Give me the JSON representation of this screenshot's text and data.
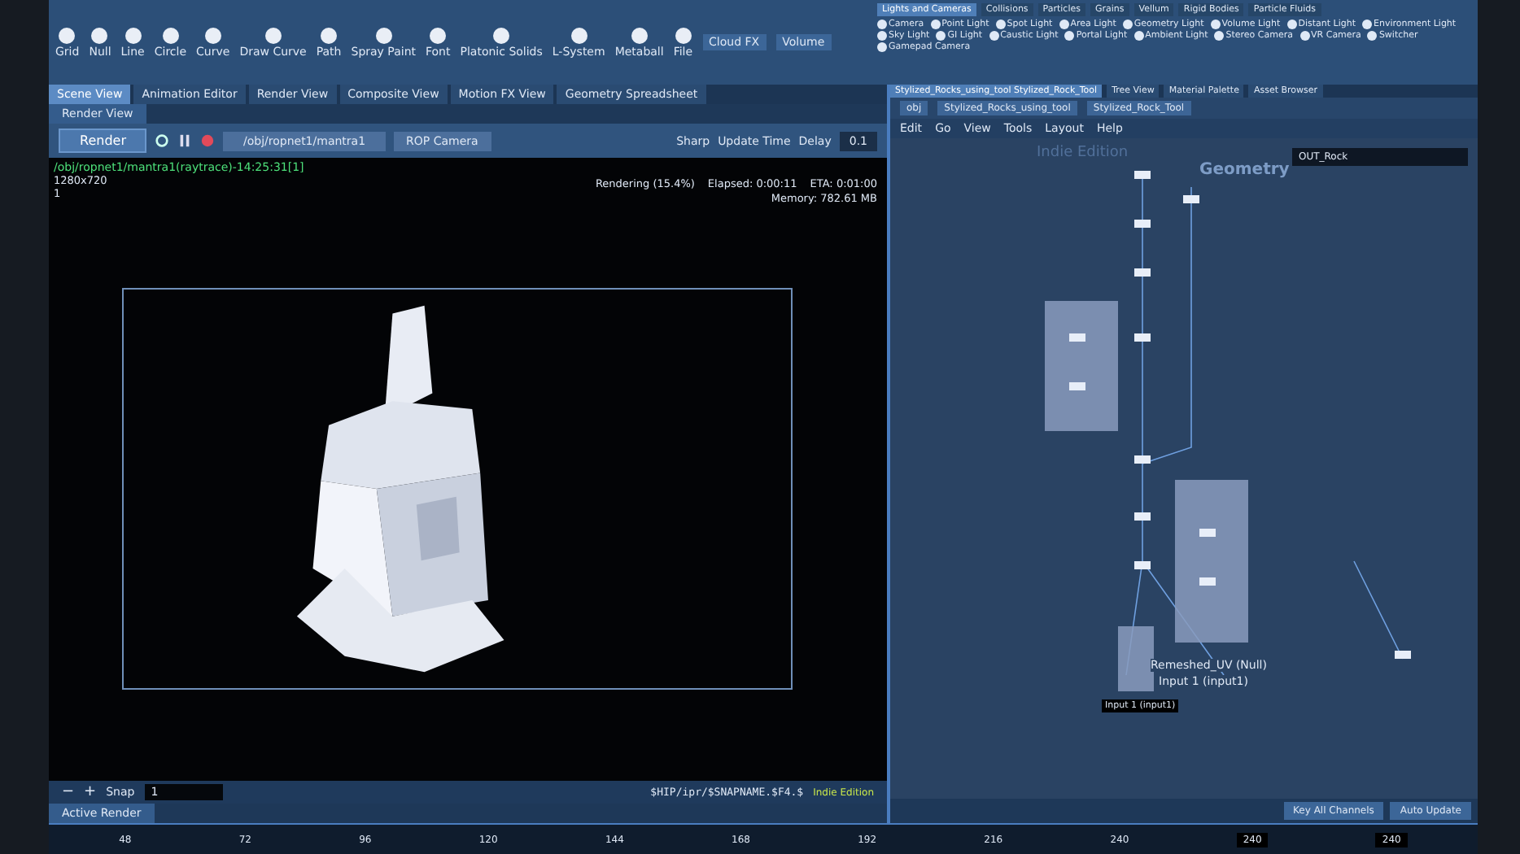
{
  "shelf": {
    "tools": [
      "Grid",
      "Null",
      "Line",
      "Circle",
      "Curve",
      "Draw Curve",
      "Path",
      "Spray Paint",
      "Font",
      "Platonic Solids",
      "L-System",
      "Metaball",
      "File"
    ],
    "tabs": [
      "Cloud FX",
      "Volume"
    ]
  },
  "pane_tabs": [
    {
      "label": "Scene View",
      "selected": true
    },
    {
      "label": "Animation Editor",
      "selected": false
    },
    {
      "label": "Render View",
      "selected": false
    },
    {
      "label": "Composite View",
      "selected": false
    },
    {
      "label": "Motion FX View",
      "selected": false
    },
    {
      "label": "Geometry Spreadsheet",
      "selected": false
    }
  ],
  "render_view": {
    "tab": "Render View",
    "render_button": "Render",
    "rop_path": "/obj/ropnet1/mantra1",
    "camera": "ROP Camera",
    "sharp": "Sharp",
    "update_time": "Update Time",
    "delay_label": "Delay",
    "delay_value": "0.1",
    "info_lines": [
      "/obj/ropnet1/mantra1(raytrace)-14:25:31[1]",
      "1280x720",
      "1"
    ],
    "progress": "Rendering (15.4%)",
    "elapsed": "Elapsed: 0:00:11",
    "eta": "ETA: 0:01:00",
    "memory": "Memory: 782.61 MB",
    "output_path": "$HIP/ipr/$SNAPNAME.$F4.$",
    "edition": "Indie Edition",
    "zoom_buttons": [
      "−",
      "+"
    ],
    "snap_label": "Snap",
    "snap_value": "1",
    "bottom_tab": "Active Render"
  },
  "light_shelf": {
    "tabs": [
      {
        "label": "Lights and Cameras",
        "selected": true
      },
      {
        "label": "Collisions",
        "selected": false
      },
      {
        "label": "Particles",
        "selected": false
      },
      {
        "label": "Grains",
        "selected": false
      },
      {
        "label": "Vellum",
        "selected": false
      },
      {
        "label": "Rigid Bodies",
        "selected": false
      },
      {
        "label": "Particle Fluids",
        "selected": false
      }
    ],
    "tools": [
      "Camera",
      "Point Light",
      "Spot Light",
      "Area Light",
      "Geometry Light",
      "Volume Light",
      "Distant Light",
      "Environment Light",
      "Sky Light",
      "GI Light",
      "Caustic Light",
      "Portal Light",
      "Ambient Light",
      "Stereo Camera",
      "VR Camera",
      "Switcher",
      "Gamepad Camera"
    ]
  },
  "network": {
    "tabs": [
      {
        "label": "Stylized_Rocks_using_tool Stylized_Rock_Tool",
        "selected": true
      },
      {
        "label": "Tree View",
        "selected": false
      },
      {
        "label": "Material Palette",
        "selected": false
      },
      {
        "label": "Asset Browser",
        "selected": false
      }
    ],
    "path": [
      "obj",
      "Stylized_Rocks_using_tool",
      "Stylized_Rock_Tool"
    ],
    "menu": [
      "Edit",
      "Go",
      "View",
      "Tools",
      "Layout",
      "Help"
    ],
    "edition": "Indie Edition",
    "context": "Geometry",
    "search_value": "OUT_Rock",
    "node_label": "Remeshed_UV (Null)",
    "input_label": "Input 1 (input1)",
    "tooltip": "Input 1 (input1)"
  },
  "timeline": {
    "ticks": [
      "48",
      "72",
      "96",
      "120",
      "144",
      "168",
      "192",
      "216",
      "240"
    ],
    "end_values": [
      "240",
      "240"
    ]
  },
  "controls": [
    "Key All Channels",
    "Auto Update"
  ]
}
